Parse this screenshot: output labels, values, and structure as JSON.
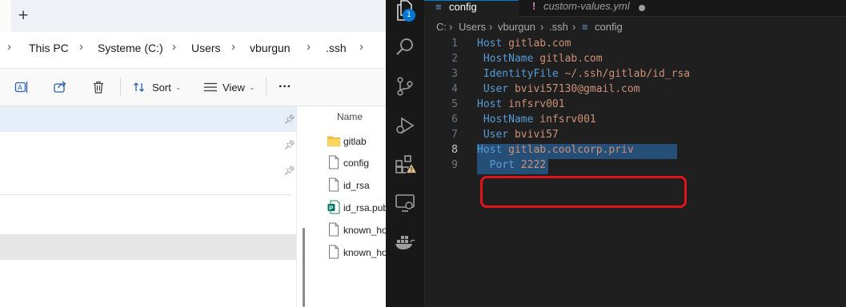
{
  "explorer": {
    "new_tab": "+",
    "address": {
      "segments": [
        "This PC",
        "Systeme (C:)",
        "Users",
        "vburgun",
        ".ssh"
      ]
    },
    "toolbar": {
      "sort_label": "Sort",
      "view_label": "View",
      "more_label": "···"
    },
    "files": {
      "column_name": "Name",
      "items": [
        {
          "name": "gitlab",
          "type": "folder"
        },
        {
          "name": "config",
          "type": "file"
        },
        {
          "name": "id_rsa",
          "type": "file"
        },
        {
          "name": "id_rsa.pub",
          "type": "publisher"
        },
        {
          "name": "known_ho",
          "type": "file"
        },
        {
          "name": "known_ho",
          "type": "file"
        }
      ]
    }
  },
  "vscode": {
    "activity_badge": "1",
    "tabs": [
      {
        "label": "config",
        "active": true
      },
      {
        "label": "custom-values.yml",
        "active": false,
        "modified": true
      }
    ],
    "breadcrumb": [
      "C:",
      "Users",
      "vburgun",
      ".ssh",
      "config"
    ],
    "lines": [
      {
        "n": "1",
        "key": "Host",
        "value": "gitlab.com"
      },
      {
        "n": "2",
        "key": "HostName",
        "value": "gitlab.com"
      },
      {
        "n": "3",
        "key": "IdentityFile",
        "value": "~/.ssh/gitlab/id_rsa"
      },
      {
        "n": "4",
        "key": "User",
        "value": "bvivi57130@gmail.com"
      },
      {
        "n": "5",
        "key": "Host",
        "value": "infsrv001"
      },
      {
        "n": "6",
        "key": "HostName",
        "value": "infsrv001"
      },
      {
        "n": "7",
        "key": "User",
        "value": "bvivi57"
      },
      {
        "n": "8",
        "key": "Host",
        "value": "gitlab.coolcorp.priv"
      },
      {
        "n": "9",
        "key": "Port",
        "value": "2222"
      }
    ],
    "colors": {
      "keyword": "#569cd6",
      "value": "#ce9178",
      "selection": "#264f78",
      "highlight_border": "#e0151c"
    }
  }
}
